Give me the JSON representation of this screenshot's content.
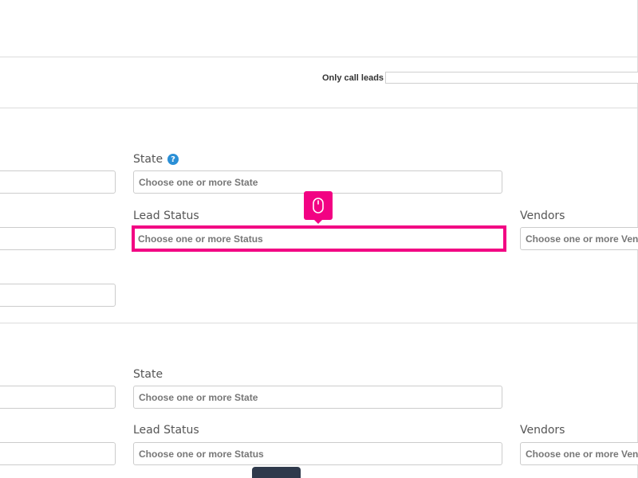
{
  "filters": {
    "only_call_leads_label": "Only call leads",
    "only_call_leads_value": ""
  },
  "section1": {
    "state_label": "State",
    "state_placeholder": "Choose one or more State",
    "lead_status_label": "Lead Status",
    "lead_status_placeholder": "Choose one or more Status",
    "vendors_label": "Vendors",
    "vendors_placeholder": "Choose one or more Vendors"
  },
  "section2": {
    "state_label": "State",
    "state_placeholder": "Choose one or more State",
    "lead_status_label": "Lead Status",
    "lead_status_placeholder": "Choose one or more Status",
    "vendors_label": "Vendors",
    "vendors_placeholder": "Choose one or more Vendors"
  },
  "colors": {
    "highlight": "#f20283",
    "help_icon": "#2a8fd6",
    "bottom_tab": "#2f3a4c"
  },
  "icons": {
    "help": "question-circle-icon",
    "cursor": "mouse-icon"
  }
}
